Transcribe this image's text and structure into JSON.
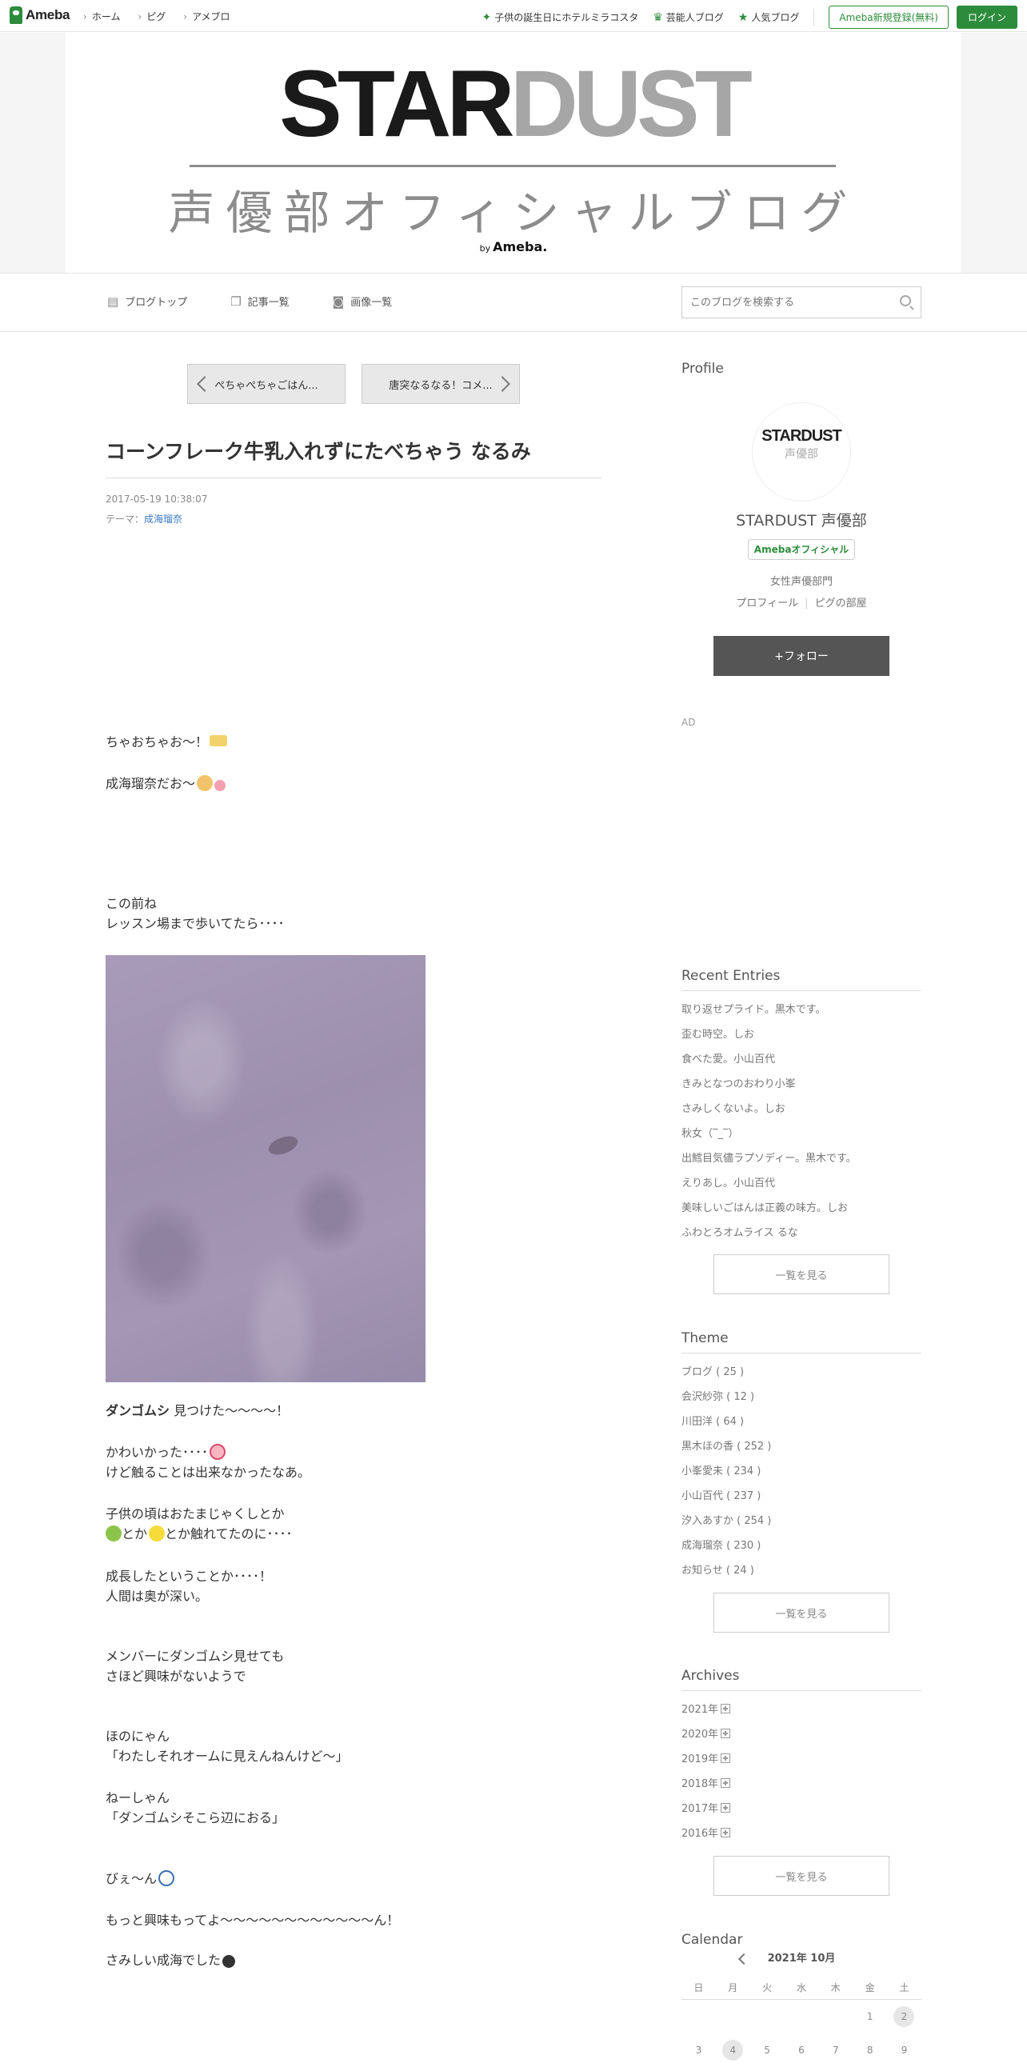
{
  "topbar": {
    "brand": "Ameba",
    "nav": [
      "ホーム",
      "ピグ",
      "アメブロ"
    ],
    "right_links": [
      {
        "label": "子供の誕生日にホテルミラコスタ",
        "icon": "sparkle-icon"
      },
      {
        "label": "芸能人ブログ",
        "icon": "crown-icon"
      },
      {
        "label": "人気ブログ",
        "icon": "star-icon"
      }
    ],
    "register_label": "Ameba新規登録(無料)",
    "login_label": "ログイン"
  },
  "banner": {
    "title_part1": "STAR",
    "title_part2": "DUST",
    "subtitle": "声優部オフィシャルブログ",
    "by_prefix": "by",
    "by_brand": "Ameba."
  },
  "blognav": {
    "items": [
      {
        "label": "ブログトップ",
        "icon": "document-icon"
      },
      {
        "label": "記事一覧",
        "icon": "copy-icon"
      },
      {
        "label": "画像一覧",
        "icon": "camera-icon"
      }
    ],
    "search_placeholder": "このブログを検索する"
  },
  "pager": {
    "prev_label": "ぺちゃぺちゃごはん...",
    "next_label": "唐突なるなる！コメ..."
  },
  "entry": {
    "title": "コーンフレーク牛乳入れずにたべちゃう なるみ",
    "date": "2017-05-19 10:38:07",
    "theme_prefix": "テーマ：",
    "theme": "成海瑠奈",
    "p1": "ちゃおちゃお〜！",
    "p2": "成海瑠奈だお〜",
    "p3a": "この前ね",
    "p3b": "レッスン場まで歩いてたら････",
    "p4_bold": "ダンゴムシ",
    "p4_rest": " 見つけた〜〜〜〜！",
    "p5a": "かわいかった････",
    "p5b": "けど触ることは出来なかったなあ。",
    "p6a": "子供の頃はおたまじゃくしとか",
    "p6b_mid": "とか",
    "p6b_end": "とか触れてたのに････",
    "p7a": "成長したということか････！",
    "p7b": "人間は奥が深い。",
    "p8a": "メンバーにダンゴムシ見せても",
    "p8b": "さほど興味がないようで",
    "p9a": "ほのにゃん",
    "p9b": "「わたしそれオームに見えんねんけど〜」",
    "p10a": "ねーしゃん",
    "p10b": "「ダンゴムシそこら辺におる」",
    "p11": "びぇ〜ん",
    "p12": "もっと興味もってよ〜〜〜〜〜〜〜〜〜〜〜〜ん！",
    "p13": "さみしい成海でした"
  },
  "sidebar": {
    "profile_heading": "Profile",
    "avatar_line1": "STARDUST",
    "avatar_line2": "声優部",
    "name": "STARDUST 声優部",
    "badge": "Amebaオフィシャル",
    "category": "女性声優部門",
    "link_profile": "プロフィール",
    "link_pig": "ピグの部屋",
    "follow_label": "+フォロー",
    "ad_label": "AD",
    "recent_heading": "Recent Entries",
    "recent": [
      "取り返せプライド。黒木です。",
      "歪む時空。しお",
      "食べた愛。小山百代",
      "きみとなつのおわり小峯",
      "さみしくないよ。しお",
      "秋女（‾_‾）",
      "出鱈目気儘ラプソディー。黒木です。",
      "えりあし。小山百代",
      "美味しいごはんは正義の味方。しお",
      "ふわとろオムライス るな"
    ],
    "more_label": "一覧を見る",
    "theme_heading": "Theme",
    "themes": [
      "ブログ ( 25 )",
      "会沢紗弥 ( 12 )",
      "川田洋 ( 64 )",
      "黒木ほの香 ( 252 )",
      "小峯愛未 ( 234 )",
      "小山百代 ( 237 )",
      "汐入あすか ( 254 )",
      "成海瑠奈 ( 230 )",
      "お知らせ ( 24 )"
    ],
    "archives_heading": "Archives",
    "archives": [
      "2021年",
      "2020年",
      "2019年",
      "2018年",
      "2017年",
      "2016年"
    ],
    "calendar_heading": "Calendar",
    "calendar_month": "2021年 10月",
    "calendar_dow": [
      "日",
      "月",
      "火",
      "水",
      "木",
      "金",
      "土"
    ],
    "calendar_row1": [
      "",
      "",
      "",
      "",
      "",
      "1",
      "2"
    ],
    "calendar_row2": [
      "3",
      "4",
      "5",
      "6",
      "7",
      "8",
      "9"
    ]
  },
  "colors": {
    "accent": "#2d8c3c",
    "link": "#3a78c4",
    "follow_bg": "#555555"
  }
}
